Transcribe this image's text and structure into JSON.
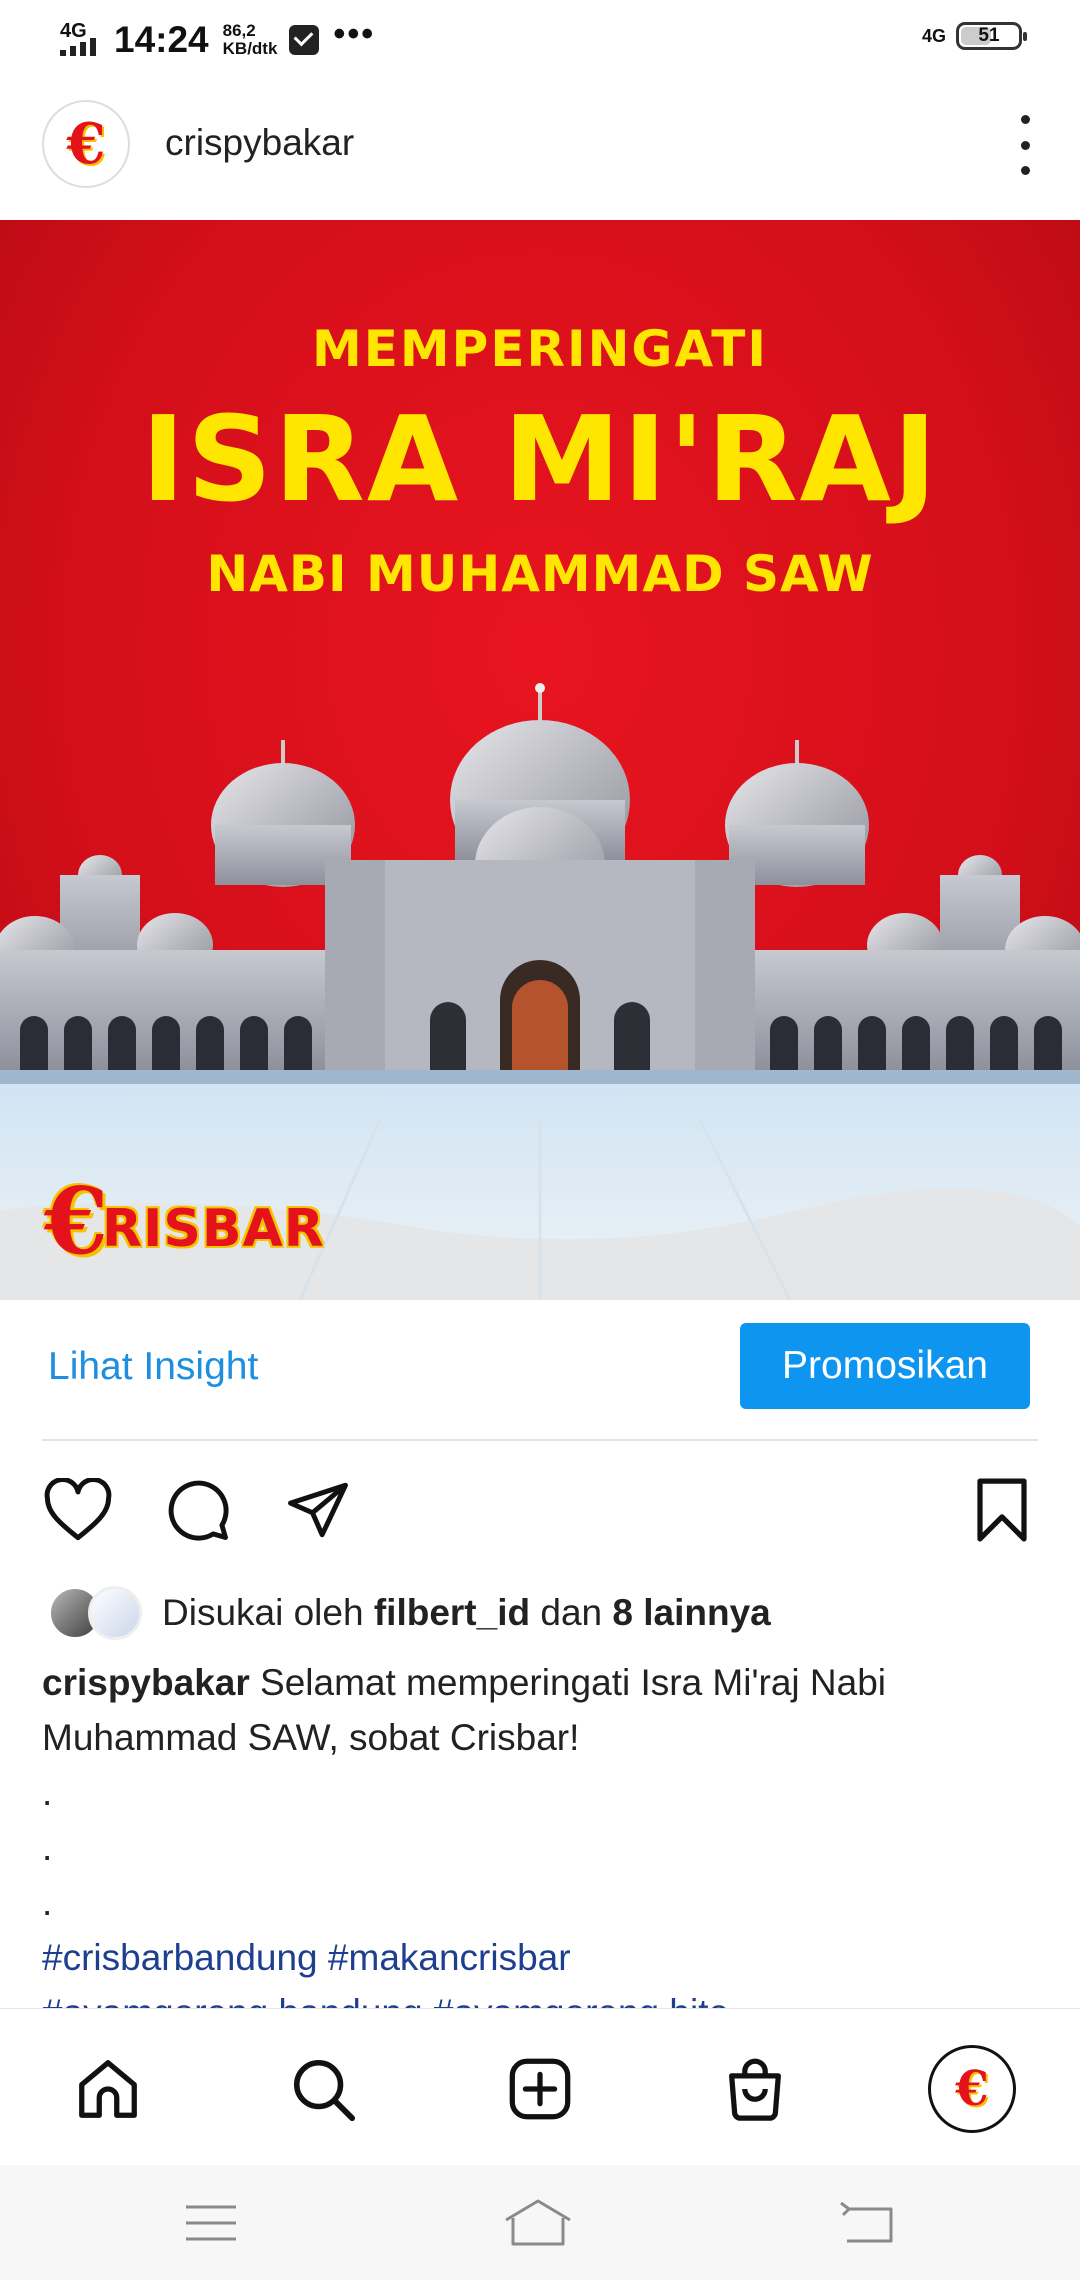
{
  "status_bar": {
    "network": "4G",
    "time": "14:24",
    "speed_value": "86,2",
    "speed_unit": "KB/dtk",
    "more": "•••",
    "network_right": "4G",
    "battery": "51"
  },
  "post": {
    "username": "crispybakar",
    "avatar_letter": "€",
    "image": {
      "line1": "MEMPERINGATI",
      "line2": "ISRA MI'RAJ",
      "line3": "NABI MUHAMMAD SAW",
      "brand_letter": "€",
      "brand_text": "RISBAR"
    },
    "insight_label": "Lihat Insight",
    "promote_label": "Promosikan",
    "likes": {
      "prefix": "Disukai oleh",
      "user": "filbert_id",
      "conj": "dan",
      "others": "8 lainnya"
    },
    "caption": {
      "user": "crispybakar",
      "text": "Selamat memperingati Isra Mi'raj Nabi Muhammad SAW, sobat Crisbar!",
      "dots": [
        ".",
        ".",
        "."
      ],
      "hashtags_line1": "#crisbarbandung #makancrisbar",
      "hashtags_line2": "#ayamgoreng bandung #ayamgoreng bite"
    }
  },
  "icons": {
    "like": "heart-icon",
    "comment": "comment-icon",
    "share": "paper-plane-icon",
    "save": "bookmark-icon",
    "home": "home-icon",
    "search": "search-icon",
    "create": "plus-square-icon",
    "shop": "shopping-bag-icon",
    "menu": "menu-icon",
    "sys_home": "home-outline-icon",
    "back": "back-icon"
  },
  "colors": {
    "accent_blue": "#0d95ef",
    "link_blue": "#1d8fe1",
    "post_red": "#d40f1a",
    "headline_yellow": "#ffe600",
    "hashtag_blue": "#1e3f8f"
  }
}
